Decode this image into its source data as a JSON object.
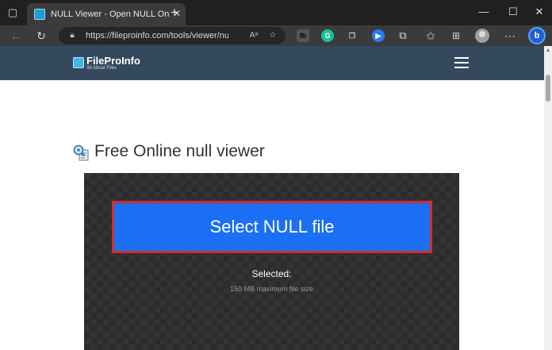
{
  "browser": {
    "tab": {
      "title": "NULL Viewer - Open NULL Onlin"
    },
    "address": {
      "url": "https://fileproinfo.com/tools/viewer/null"
    },
    "reader_label": "Aᵃ",
    "window_controls": {
      "minimize": "—",
      "maximize": "☐",
      "close": "✕"
    },
    "extensions": [
      {
        "name": "sb-extension-icon",
        "glyph": "fb",
        "color": "#e8e8e8"
      },
      {
        "name": "grammarly-icon",
        "glyph": "G",
        "color": "#15c39a"
      },
      {
        "name": "copy-extension-icon",
        "glyph": "❐",
        "color": "#cfcfcf"
      },
      {
        "name": "screen-recorder-icon",
        "glyph": "▶",
        "color": "#2a7bf0"
      }
    ],
    "bing_label": "b"
  },
  "site": {
    "logo": {
      "name": "FileProInfo",
      "tagline": "All About Files"
    }
  },
  "main": {
    "title": "Free Online null viewer",
    "select_button_label": "Select NULL file",
    "selected_label": "Selected:",
    "size_note": "150 MB maximum file size"
  },
  "colors": {
    "header_bg": "#34495e",
    "button_blue": "#1a6ff5",
    "button_border": "#d62b2b",
    "panel_bg": "#333333"
  }
}
